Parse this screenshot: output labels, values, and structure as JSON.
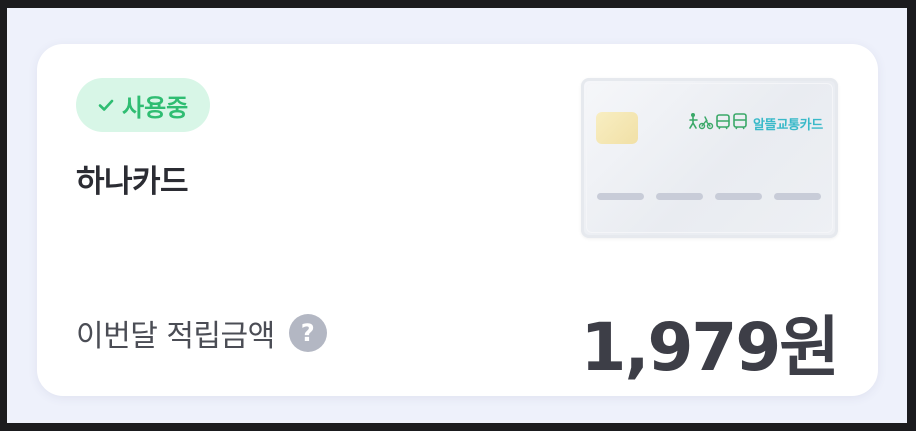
{
  "status_badge": {
    "label": "사용중",
    "icon": "check-icon",
    "color": "#2fbd72",
    "background": "#d8f6e7"
  },
  "card": {
    "name": "하나카드",
    "logo_text": "알뜰교통카드",
    "logo_icon": "transport-figures-icon"
  },
  "accrual": {
    "label": "이번달 적립금액",
    "help_icon": "question-icon",
    "help_symbol": "?",
    "amount": "1,979원"
  }
}
